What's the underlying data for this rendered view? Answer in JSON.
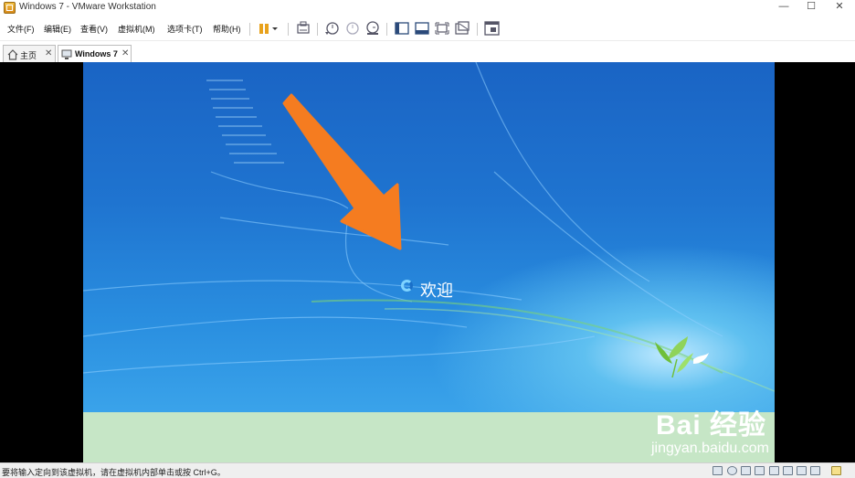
{
  "window": {
    "title": "Windows 7 - VMware Workstation",
    "minimize": "—",
    "maximize": "☐",
    "close": "✕"
  },
  "menu": [
    "文件(F)",
    "编辑(E)",
    "查看(V)",
    "虚拟机(M)",
    "选项卡(T)",
    "帮助(H)"
  ],
  "toolbar_icons": [
    "pause-icon",
    "dropdown-icon",
    "send-keys-icon",
    "snapshot-icon",
    "revert-snapshot-icon",
    "snapshot-manager-icon",
    "show-library-icon",
    "thumbnail-bar-icon",
    "full-screen-icon",
    "unity-icon",
    "console-view-icon"
  ],
  "tabs": [
    {
      "label": "主页",
      "icon": "home-icon",
      "close": "✕"
    },
    {
      "label": "Windows 7",
      "icon": "vm-icon",
      "close": "✕"
    }
  ],
  "guest": {
    "welcome": "欢迎"
  },
  "status": {
    "text": "要将输入定向到该虚拟机，请在虚拟机内部单击或按 Ctrl+G。"
  },
  "watermark": {
    "top": "Bai 经验",
    "bottom": "jingyan.baidu.com"
  },
  "colors": {
    "arrow": "#f57c20",
    "desktop": "#1f74d0",
    "panel": "#c6e6c6"
  }
}
